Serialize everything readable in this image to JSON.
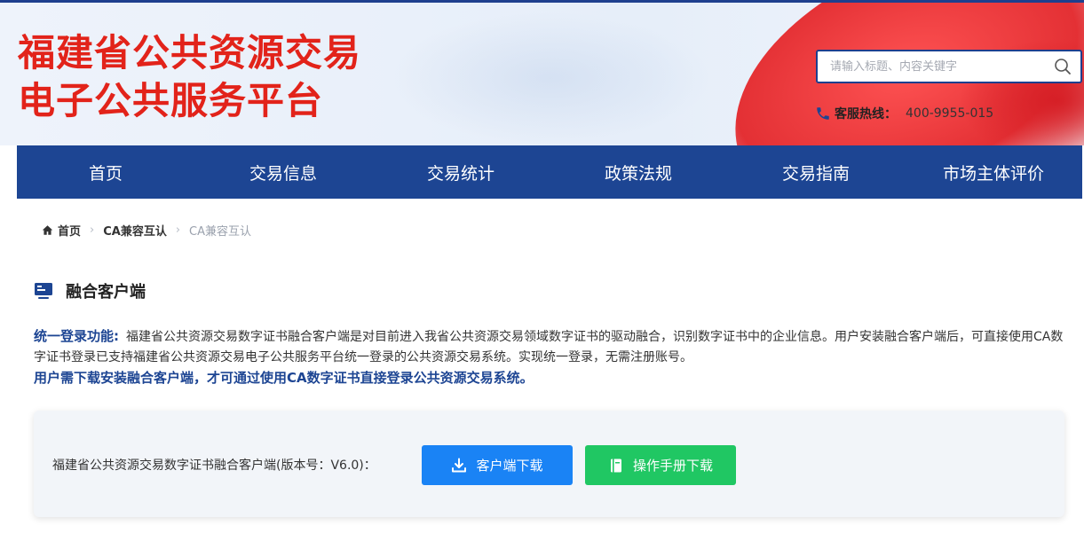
{
  "header": {
    "logo_line1": "福建省公共资源交易",
    "logo_line2": "电子公共服务平台",
    "search_placeholder": "请输入标题、内容关键字",
    "hotline_label": "客服热线：",
    "hotline_number": "400-9955-015"
  },
  "nav": {
    "items": [
      "首页",
      "交易信息",
      "交易统计",
      "政策法规",
      "交易指南",
      "市场主体评价"
    ]
  },
  "breadcrumb": {
    "home": "首页",
    "level1": "CA兼容互认",
    "current": "CA兼容互认"
  },
  "section": {
    "title": "融合客户端",
    "lead": "统一登录功能:",
    "body": "福建省公共资源交易数字证书融合客户端是对目前进入我省公共资源交易领域数字证书的驱动融合，识别数字证书中的企业信息。用户安装融合客户端后，可直接使用CA数字证书登录已支持福建省公共资源交易电子公共服务平台统一登录的公共资源交易系统。实现统一登录，无需注册账号。",
    "emphasis": "用户需下载安装融合客户端，才可通过使用CA数字证书直接登录公共资源交易系统。"
  },
  "download": {
    "client_label": "福建省公共资源交易数字证书融合客户端(版本号：V6.0)：",
    "client_button": "客户端下载",
    "manual_button": "操作手册下载"
  },
  "colors": {
    "brand_red": "#e2231a",
    "nav_blue": "#1d4593",
    "download_blue": "#1a83f5",
    "manual_green": "#20c763"
  }
}
